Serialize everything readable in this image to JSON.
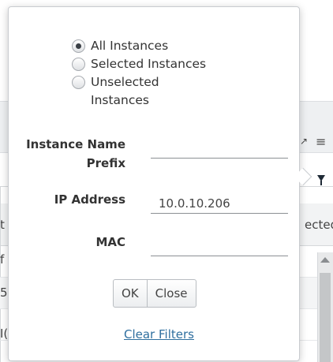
{
  "background": {
    "header_icons": [
      "expand-icon",
      "menu-icon"
    ],
    "col_fragment_left": "t",
    "col_fragment_right": "ected",
    "row_fragments": [
      "f",
      "5",
      "I("
    ]
  },
  "filter_popover": {
    "scope_options": [
      {
        "label": "All Instances",
        "checked": true
      },
      {
        "label": "Selected Instances",
        "checked": false
      },
      {
        "label": "Unselected Instances",
        "checked": false
      }
    ],
    "fields": {
      "instance_name_prefix": {
        "label": "Instance Name Prefix",
        "value": ""
      },
      "ip_address": {
        "label": "IP Address",
        "value": "10.0.10.206"
      },
      "mac": {
        "label": "MAC",
        "value": ""
      }
    },
    "ok_label": "OK",
    "close_label": "Close",
    "clear_filters_label": "Clear Filters"
  }
}
